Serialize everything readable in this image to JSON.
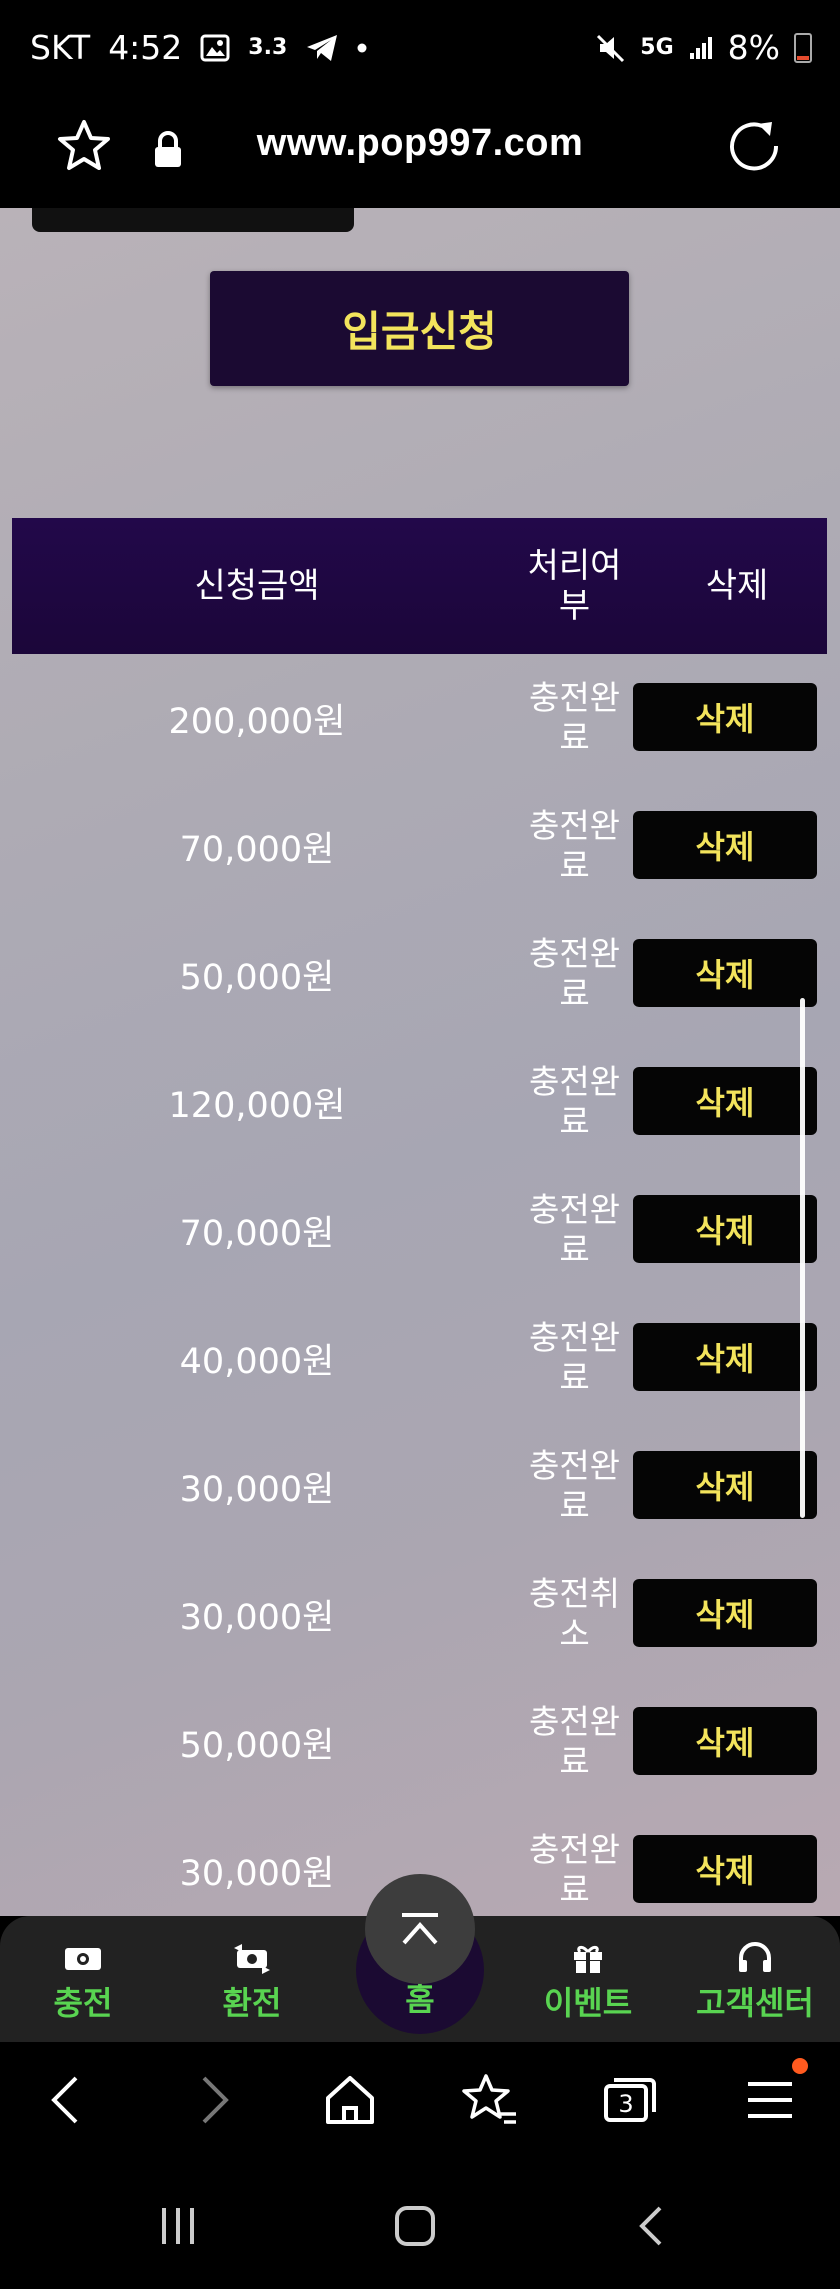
{
  "status_bar": {
    "carrier": "SKT",
    "time": "4:52",
    "notification_badge": "3.3",
    "network": "5G",
    "battery": "8%"
  },
  "browser": {
    "url": "www.pop997.com",
    "tab_count": "3"
  },
  "page": {
    "deposit_button": "입금신청",
    "table": {
      "headers": {
        "amount": "신청금액",
        "status": "처리여부",
        "delete": "삭제"
      },
      "rows": [
        {
          "amount": "200,000원",
          "status": "충전완료",
          "action": "삭제"
        },
        {
          "amount": "70,000원",
          "status": "충전완료",
          "action": "삭제"
        },
        {
          "amount": "50,000원",
          "status": "충전완료",
          "action": "삭제"
        },
        {
          "amount": "120,000원",
          "status": "충전완료",
          "action": "삭제"
        },
        {
          "amount": "70,000원",
          "status": "충전완료",
          "action": "삭제"
        },
        {
          "amount": "40,000원",
          "status": "충전완료",
          "action": "삭제"
        },
        {
          "amount": "30,000원",
          "status": "충전완료",
          "action": "삭제"
        },
        {
          "amount": "30,000원",
          "status": "충전취소",
          "action": "삭제"
        },
        {
          "amount": "50,000원",
          "status": "충전완료",
          "action": "삭제"
        },
        {
          "amount": "30,000원",
          "status": "충전완료",
          "action": "삭제"
        }
      ]
    }
  },
  "site_nav": {
    "items": [
      {
        "label": "충전",
        "icon": "money-icon"
      },
      {
        "label": "환전",
        "icon": "exchange-icon"
      },
      {
        "label": "홈",
        "icon": "home-icon"
      },
      {
        "label": "이벤트",
        "icon": "gift-icon"
      },
      {
        "label": "고객센터",
        "icon": "headset-icon"
      }
    ]
  },
  "colors": {
    "accent_yellow": "#f3e45c",
    "nav_green": "#59d451",
    "header_purple": "#1b0639"
  }
}
